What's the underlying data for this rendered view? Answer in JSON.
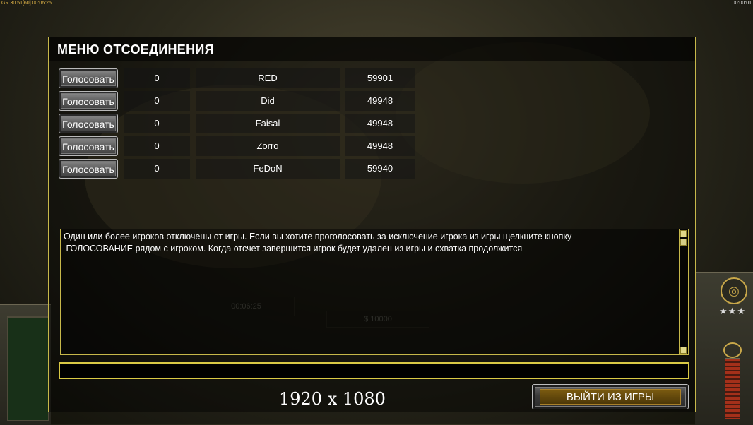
{
  "hud": {
    "top_left": "GR 30 51[60] 00:06:25",
    "top_right": "00:00:01",
    "ghost_time": "00:06:25",
    "ghost_money": "$ 10000"
  },
  "dialog": {
    "title": "МЕНЮ ОТСОЕДИНЕНИЯ",
    "rows": [
      {
        "vote_label": "Голосовать",
        "count": "0",
        "name": "RED",
        "ping": "59901"
      },
      {
        "vote_label": "Голосовать",
        "count": "0",
        "name": "Did",
        "ping": "49948"
      },
      {
        "vote_label": "Голосовать",
        "count": "0",
        "name": "Faisal",
        "ping": "49948"
      },
      {
        "vote_label": "Голосовать",
        "count": "0",
        "name": "Zorro",
        "ping": "49948"
      },
      {
        "vote_label": "Голосовать",
        "count": "0",
        "name": "FeDoN",
        "ping": "59940"
      }
    ],
    "message_line1": "Один или более игроков отключены от игры. Если вы хотите проголосовать за исключение игрока из игры щелкните кнопку",
    "message_line2": " ГОЛОСОВАНИЕ рядом с игроком. Когда отсчет завершится игрок будет удален из игры и схватка продолжится",
    "chat_value": "",
    "exit_label": "ВЫЙТИ ИЗ ИГРЫ"
  },
  "overlay": {
    "resolution": "1920 x 1080"
  },
  "colors": {
    "accent_border": "#c7b84a",
    "input_border": "#d9c945",
    "exit_fill": "#7a5a10"
  }
}
